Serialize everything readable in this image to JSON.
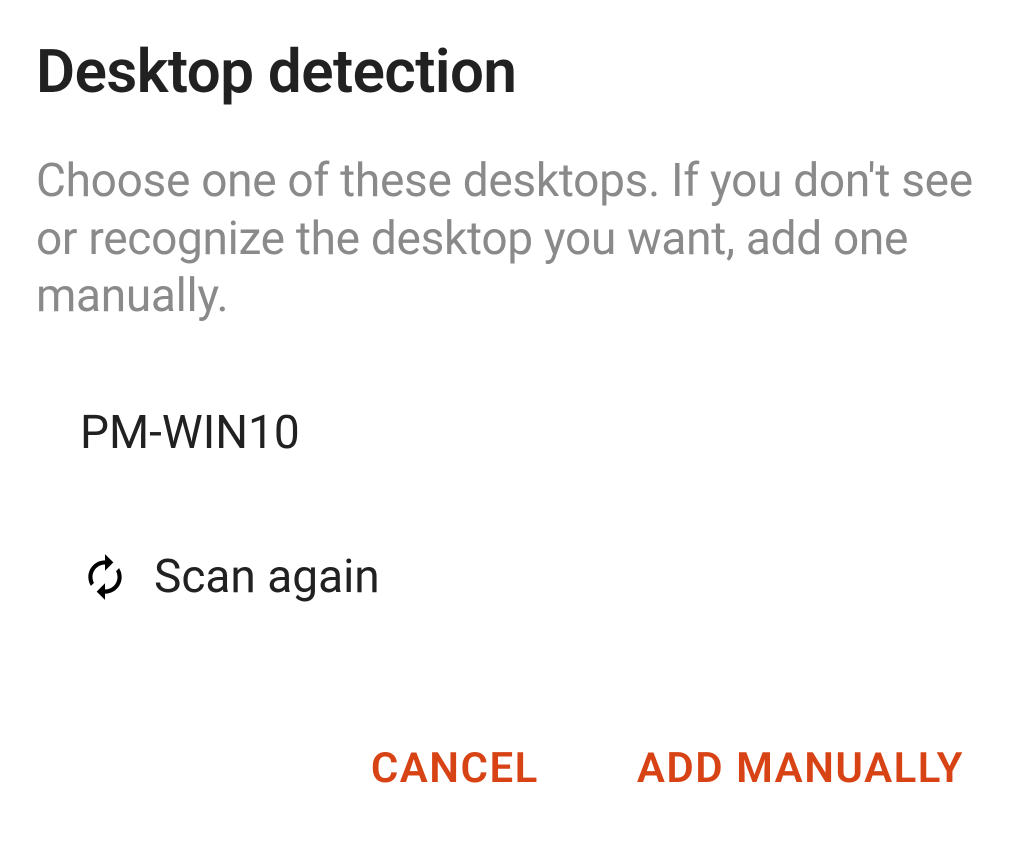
{
  "dialog": {
    "title": "Desktop detection",
    "description": "Choose one of these desktops. If you don't see or recognize the desktop you want, add one manually.",
    "desktops": [
      {
        "name": "PM-WIN10"
      }
    ],
    "scan_again_label": "Scan again",
    "actions": {
      "cancel": "CANCEL",
      "add_manually": "ADD MANUALLY"
    }
  },
  "colors": {
    "accent": "#d84315",
    "text_primary": "#212121",
    "text_secondary": "#8a8a8a"
  }
}
